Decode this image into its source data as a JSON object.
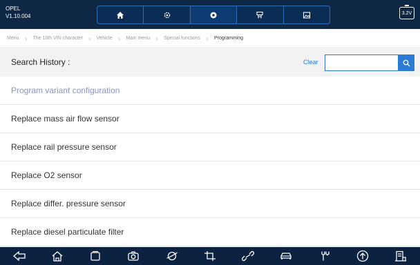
{
  "header": {
    "make": "OPEL",
    "version": "V1.10.004",
    "tabs": [
      {
        "icon": "home-icon",
        "active": false
      },
      {
        "icon": "settings-icon",
        "active": false
      },
      {
        "icon": "record-icon",
        "active": true
      },
      {
        "icon": "vci-icon",
        "active": false
      },
      {
        "icon": "screenshot-icon",
        "active": false
      }
    ],
    "battery_voltage": "3.2V"
  },
  "breadcrumb": [
    "Menu",
    "The 10th VIN character",
    "Vehicle",
    "Main menu",
    "Special functions",
    "Programming"
  ],
  "search": {
    "label": "Search History :",
    "clear_label": "Clear",
    "value": "",
    "placeholder": ""
  },
  "functions": [
    "Program variant configuration",
    "Replace mass air flow sensor",
    "Replace rail pressure sensor",
    "Replace O2 sensor",
    "Replace differ. pressure sensor",
    "Replace diesel particulate filter"
  ],
  "navbar": [
    "back-icon",
    "home-icon",
    "recent-apps-icon",
    "camera-icon",
    "browser-icon",
    "crop-icon",
    "link-icon",
    "car-icon",
    "tools-icon",
    "upload-icon",
    "report-icon"
  ],
  "colors": {
    "header_bg": "#0e2744",
    "accent": "#2a7bd6",
    "active_item": "#8a94c6",
    "navbar_bg": "#0b2340"
  }
}
